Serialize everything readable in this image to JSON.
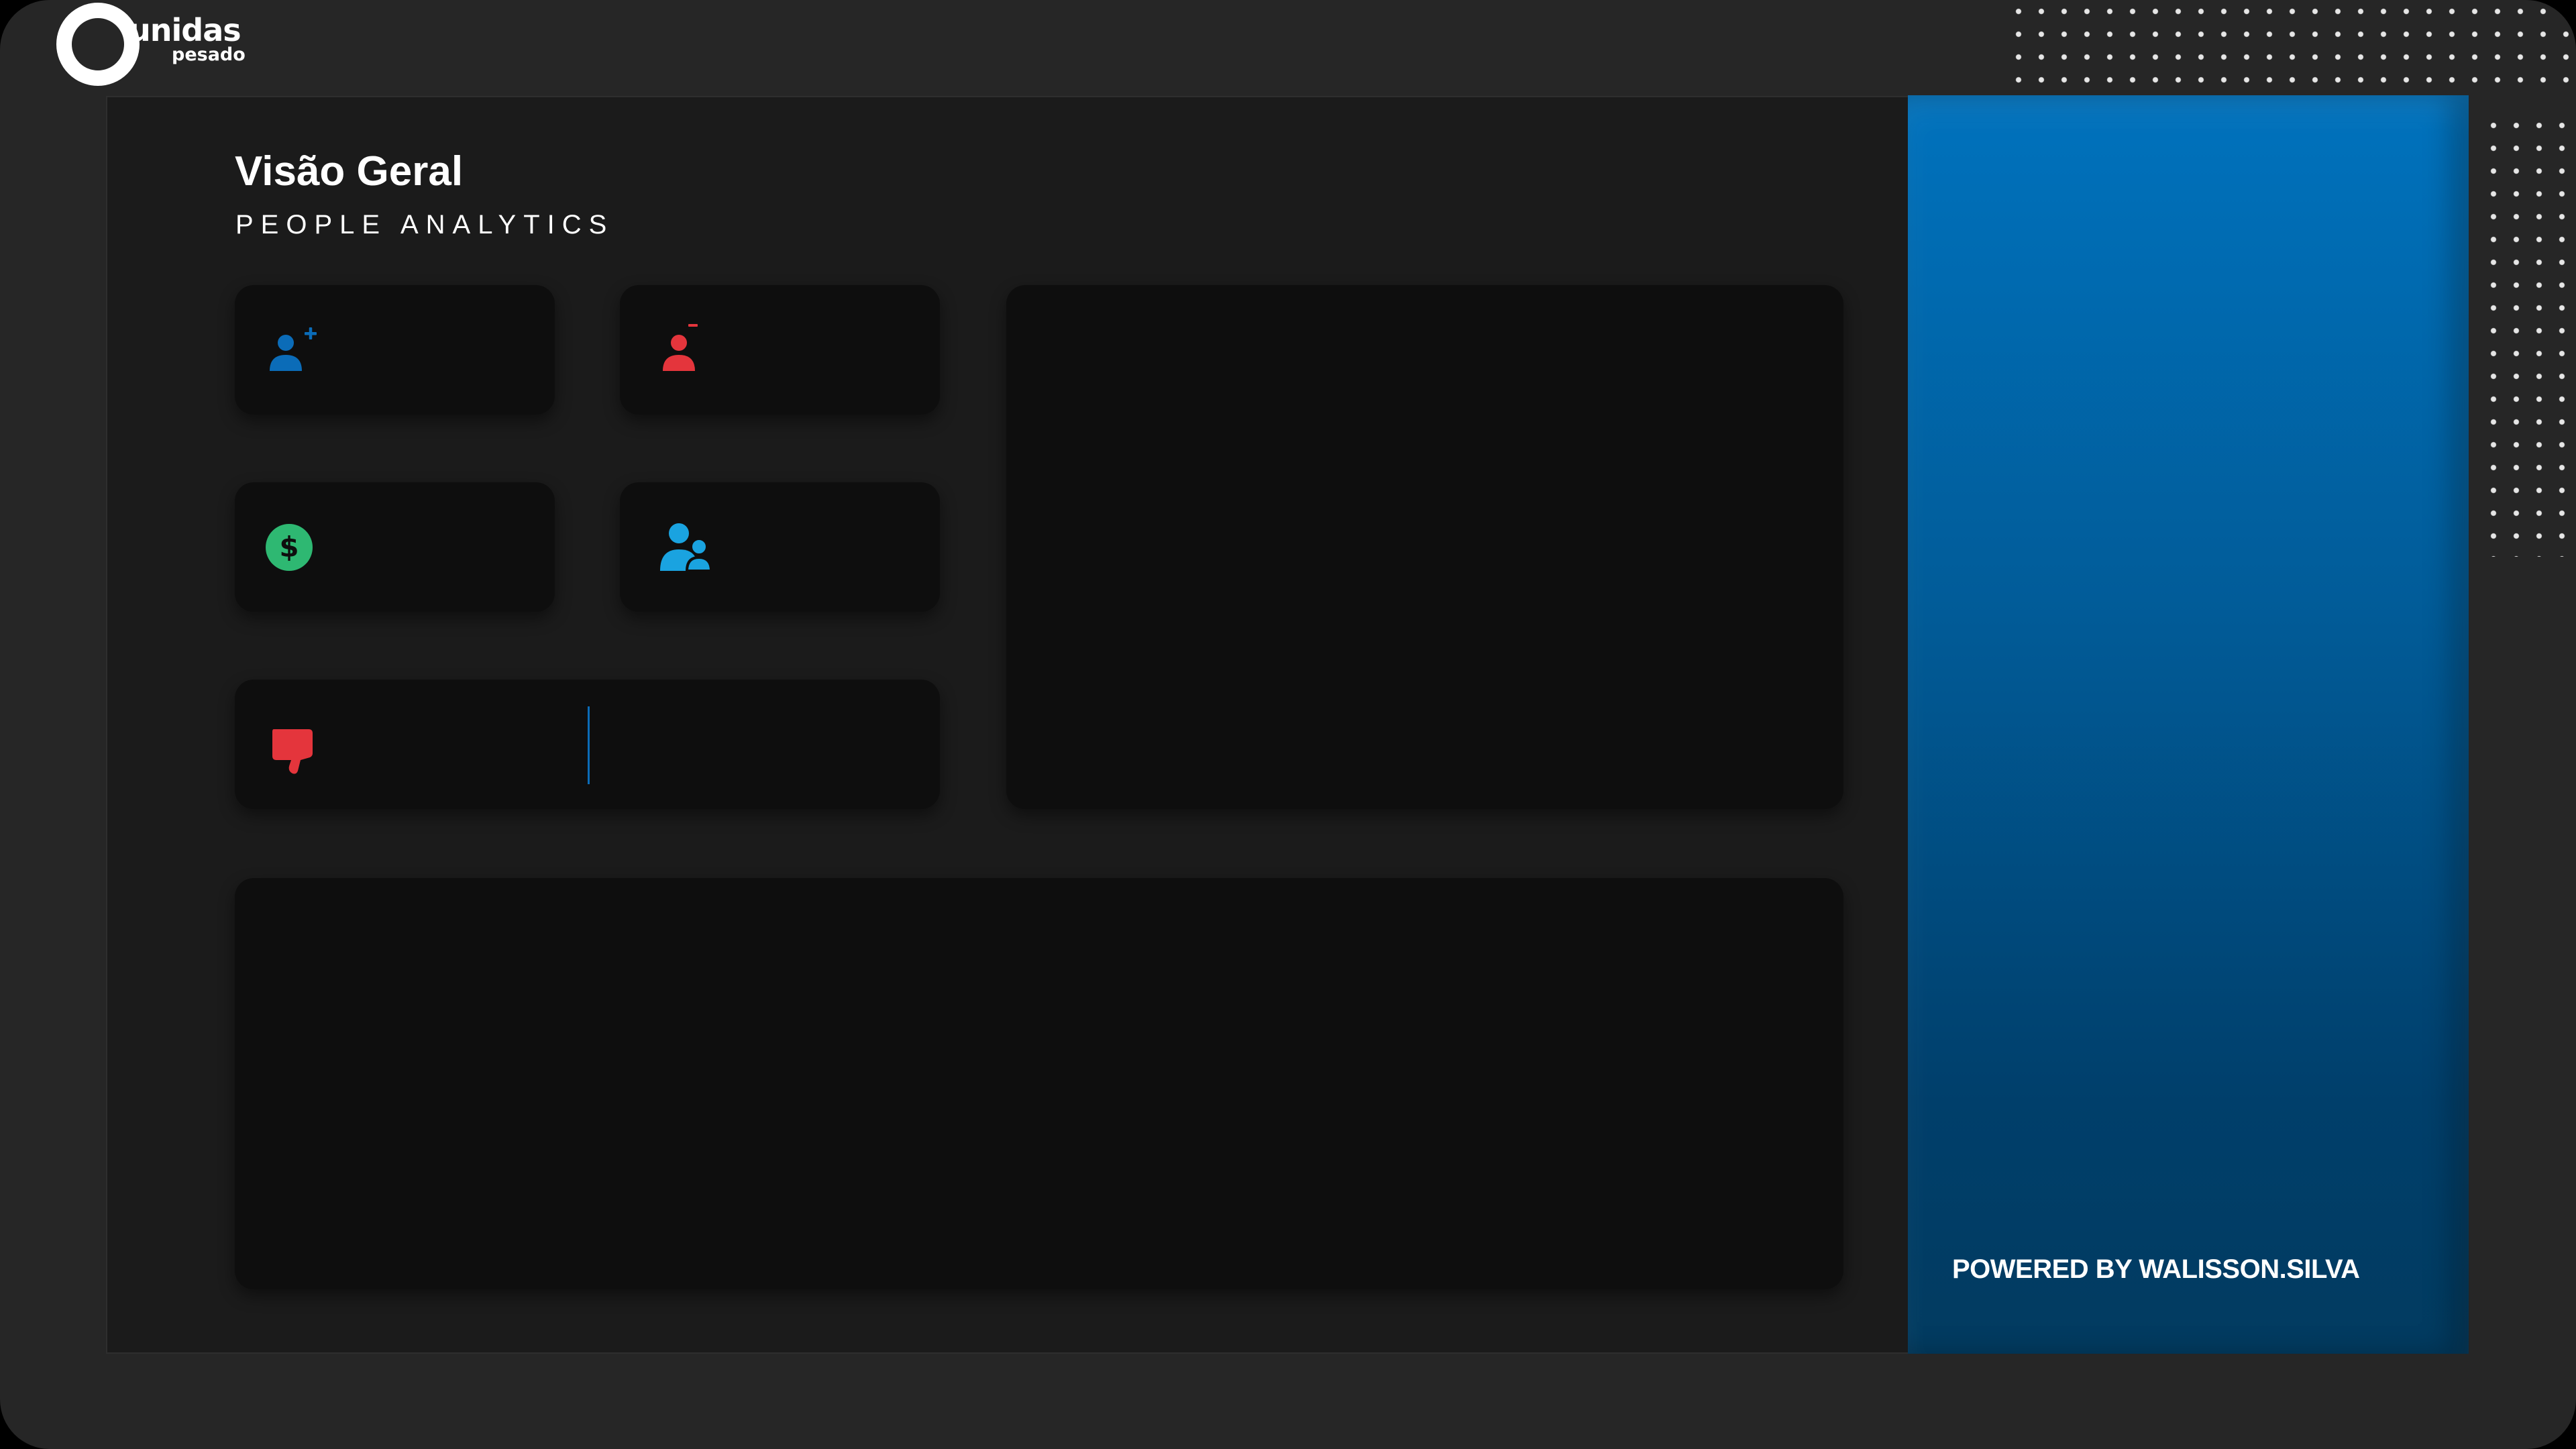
{
  "brand": {
    "name": "unidas",
    "sub": "pesado"
  },
  "header": {
    "title": "Visão Geral",
    "subtitle": "PEOPLE ANALYTICS"
  },
  "kpi_cards": [
    {
      "icon": "add-user-icon",
      "color": "#0b6cb8"
    },
    {
      "icon": "remove-user-icon",
      "color": "#e4353c"
    },
    {
      "icon": "dollar-icon",
      "color": "#2eb872"
    },
    {
      "icon": "users-icon",
      "color": "#1aa3e0"
    },
    {
      "icon": "thumbs-down-icon",
      "color": "#e4353c"
    }
  ],
  "side_panel": {
    "footer": "POWERED BY WALISSON.SILVA",
    "accent": "#0072bd"
  }
}
